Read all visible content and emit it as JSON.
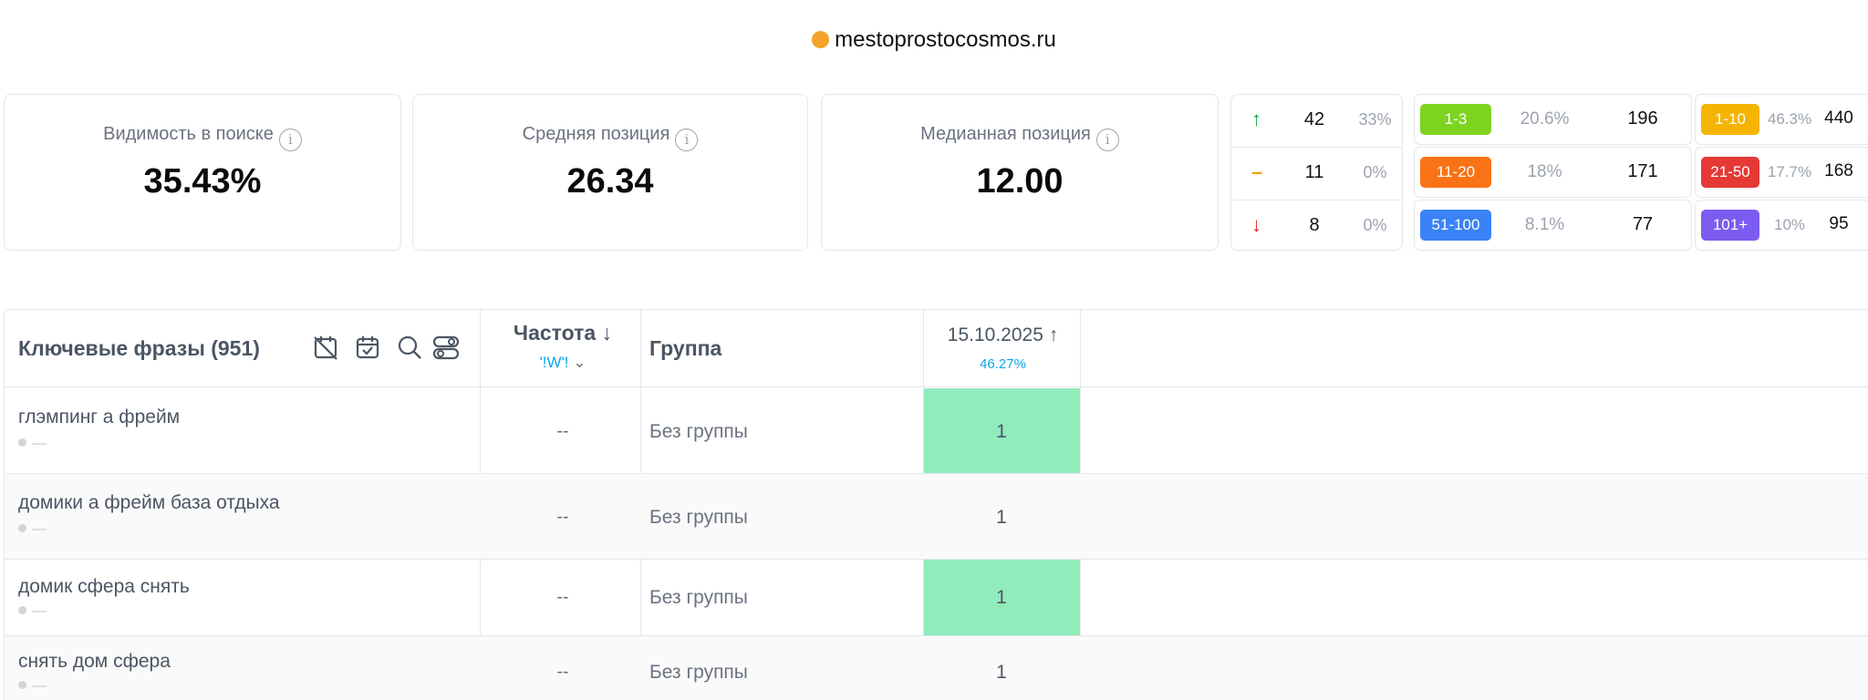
{
  "site": {
    "name": "mestoprostocosmos.ru",
    "dot_color": "#f5a12a"
  },
  "metrics": [
    {
      "label": "Видимость в поиске",
      "value": "35.43%"
    },
    {
      "label": "Средняя позиция",
      "value": "26.34"
    },
    {
      "label": "Медианная позиция",
      "value": "12.00"
    }
  ],
  "dynamics": [
    {
      "direction": "up",
      "count": "42",
      "percent": "33%",
      "color": "#16a34a"
    },
    {
      "direction": "same",
      "count": "11",
      "percent": "0%",
      "color": "#f59e0b"
    },
    {
      "direction": "down",
      "count": "8",
      "percent": "0%",
      "color": "#dc2626"
    }
  ],
  "tiers_left": [
    {
      "range": "1-3",
      "percent": "20.6%",
      "count": "196",
      "color": "#7ed321"
    },
    {
      "range": "11-20",
      "percent": "18%",
      "count": "171",
      "color": "#f97316"
    },
    {
      "range": "51-100",
      "percent": "8.1%",
      "count": "77",
      "color": "#3b82f6"
    }
  ],
  "tiers_right": [
    {
      "range": "1-10",
      "percent": "46.3%",
      "count": "440",
      "color": "#f5b400"
    },
    {
      "range": "21-50",
      "percent": "17.7%",
      "count": "168",
      "color": "#e53935"
    },
    {
      "range": "101+",
      "percent": "10%",
      "count": "95",
      "color": "#7c5cf0"
    }
  ],
  "table": {
    "title": "Ключевые фразы (951)",
    "freq_header": "Частота",
    "freq_sub": "'!W'!",
    "group_header": "Группа",
    "date_header": "15.10.2025",
    "date_sub": "46.27%",
    "rows": [
      {
        "phrase": "глэмпинг а фрейм",
        "sub": "—",
        "freq": "--",
        "group": "Без группы",
        "position": "1"
      },
      {
        "phrase": "домики а фрейм база отдыха",
        "sub": "—",
        "freq": "--",
        "group": "Без группы",
        "position": "1"
      },
      {
        "phrase": "домик сфера снять",
        "sub": "—",
        "freq": "--",
        "group": "Без группы",
        "position": "1"
      },
      {
        "phrase": "снять дом сфера",
        "sub": "—",
        "freq": "--",
        "group": "Без группы",
        "position": "1"
      }
    ]
  }
}
